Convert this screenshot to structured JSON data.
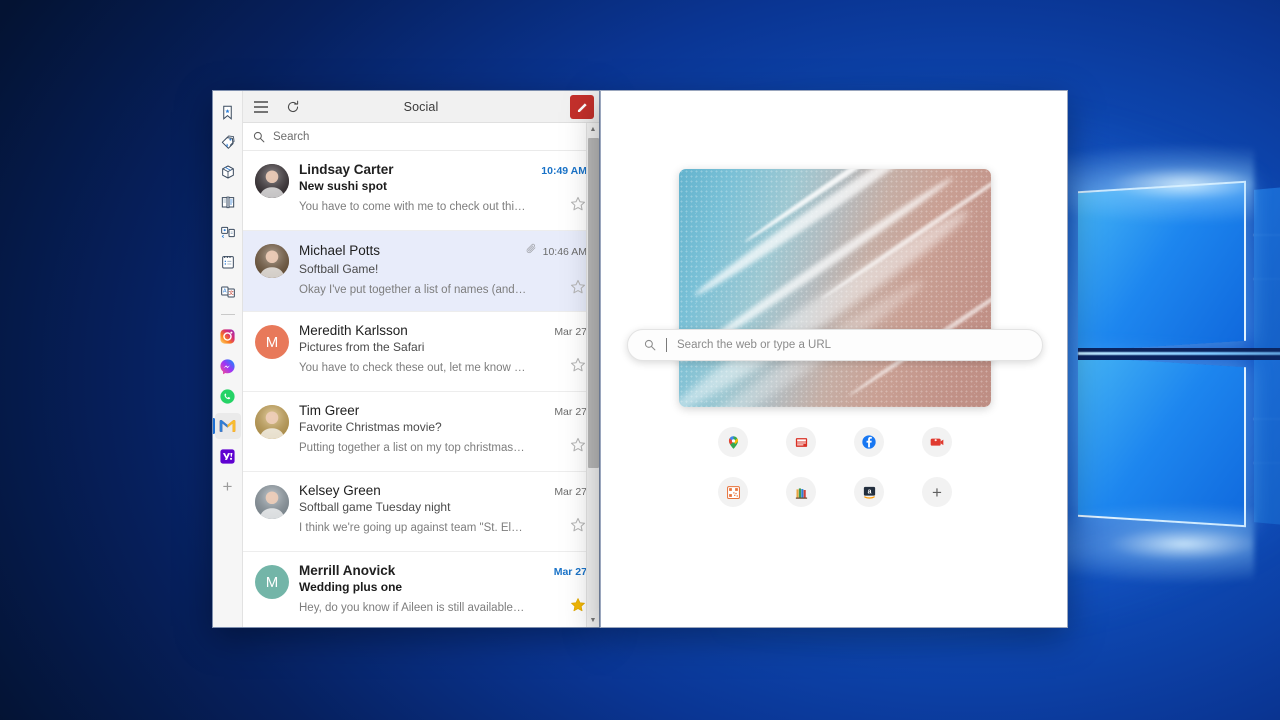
{
  "desktop": {
    "wallpaper_name": "windows-10-hero-flag",
    "bg_color": "#0a3593"
  },
  "mail_app": {
    "title": "Social",
    "toolbar": {
      "menu_icon": "hamburger-menu-icon",
      "refresh_icon": "refresh-icon",
      "compose_label": "compose-pencil-icon",
      "compose_color": "#c4302b"
    },
    "search": {
      "placeholder": "Search",
      "icon": "search-icon"
    },
    "rail": [
      {
        "name": "collections",
        "icon": "bookmark-ribbon-icon"
      },
      {
        "name": "shopping",
        "icon": "price-tags-icon"
      },
      {
        "name": "package-tracking",
        "icon": "box-icon"
      },
      {
        "name": "dictionary",
        "icon": "open-book-icon"
      },
      {
        "name": "drop",
        "icon": "devices-transfer-icon"
      },
      {
        "name": "tools",
        "icon": "clipboard-list-icon"
      },
      {
        "name": "translate",
        "icon": "translate-cards-icon"
      },
      {
        "name": "instagram",
        "icon": "instagram-icon"
      },
      {
        "name": "messenger",
        "icon": "messenger-icon"
      },
      {
        "name": "whatsapp",
        "icon": "whatsapp-icon"
      },
      {
        "name": "gmail",
        "icon": "gmail-icon",
        "selected": true
      },
      {
        "name": "yahoo",
        "icon": "yahoo-icon"
      },
      {
        "name": "add",
        "icon": "plus-icon"
      }
    ],
    "messages": [
      {
        "sender": "Lindsay Carter",
        "subject": "New sushi spot",
        "snippet": "You have to come with me to check out thi…",
        "time": "10:49 AM",
        "unread": true,
        "selected": false,
        "starred": false,
        "attachment": false,
        "avatar_type": "photo",
        "avatar_initial": "L",
        "avatar_color": "#3a3236"
      },
      {
        "sender": "Michael Potts",
        "subject": "Softball Game!",
        "snippet": "Okay I've put together a list of names (and…",
        "time": "10:46 AM",
        "unread": false,
        "selected": true,
        "starred": false,
        "attachment": true,
        "avatar_type": "photo",
        "avatar_initial": "M",
        "avatar_color": "#7a5f42"
      },
      {
        "sender": "Meredith Karlsson",
        "subject": "Pictures from the Safari",
        "snippet": "You have to check these out, let me know …",
        "time": "Mar 27",
        "unread": false,
        "selected": false,
        "starred": false,
        "attachment": false,
        "avatar_type": "initial",
        "avatar_initial": "M",
        "avatar_color": "#e8795a"
      },
      {
        "sender": "Tim Greer",
        "subject": "Favorite Christmas movie?",
        "snippet": "Putting together a list on my top christmas…",
        "time": "Mar 27",
        "unread": false,
        "selected": false,
        "starred": false,
        "attachment": false,
        "avatar_type": "photo",
        "avatar_initial": "T",
        "avatar_color": "#d9b25c"
      },
      {
        "sender": "Kelsey Green",
        "subject": "Softball game Tuesday night",
        "snippet": "I think we're going up against team \"St. El…",
        "time": "Mar 27",
        "unread": false,
        "selected": false,
        "starred": false,
        "attachment": false,
        "avatar_type": "photo",
        "avatar_initial": "K",
        "avatar_color": "#9aa7b0"
      },
      {
        "sender": "Merrill Anovick",
        "subject": "Wedding plus one",
        "snippet": "Hey, do you know if Aileen is still available…",
        "time": "Mar 27",
        "unread": true,
        "selected": false,
        "starred": true,
        "attachment": false,
        "avatar_type": "initial",
        "avatar_initial": "M",
        "avatar_color": "#73b5a8"
      }
    ],
    "scrollbar": {
      "up_arrow": "▲",
      "down_arrow": "▼"
    }
  },
  "browser": {
    "new_tab": {
      "hero_image_name": "ocean-beach-shoreline-photo",
      "search": {
        "placeholder": "Search the web or type a URL",
        "icon": "search-icon"
      },
      "shortcuts": [
        {
          "name": "google-maps",
          "icon": "map-pin-icon"
        },
        {
          "name": "news",
          "icon": "red-newspaper-icon"
        },
        {
          "name": "facebook",
          "icon": "facebook-icon"
        },
        {
          "name": "youtube",
          "icon": "red-video-icon"
        },
        {
          "name": "qr-code-site",
          "icon": "orange-qr-icon"
        },
        {
          "name": "books",
          "icon": "colored-books-icon"
        },
        {
          "name": "amazon",
          "icon": "amazon-icon"
        },
        {
          "name": "add-shortcut",
          "icon": "plus-icon",
          "label": "+"
        }
      ]
    }
  }
}
